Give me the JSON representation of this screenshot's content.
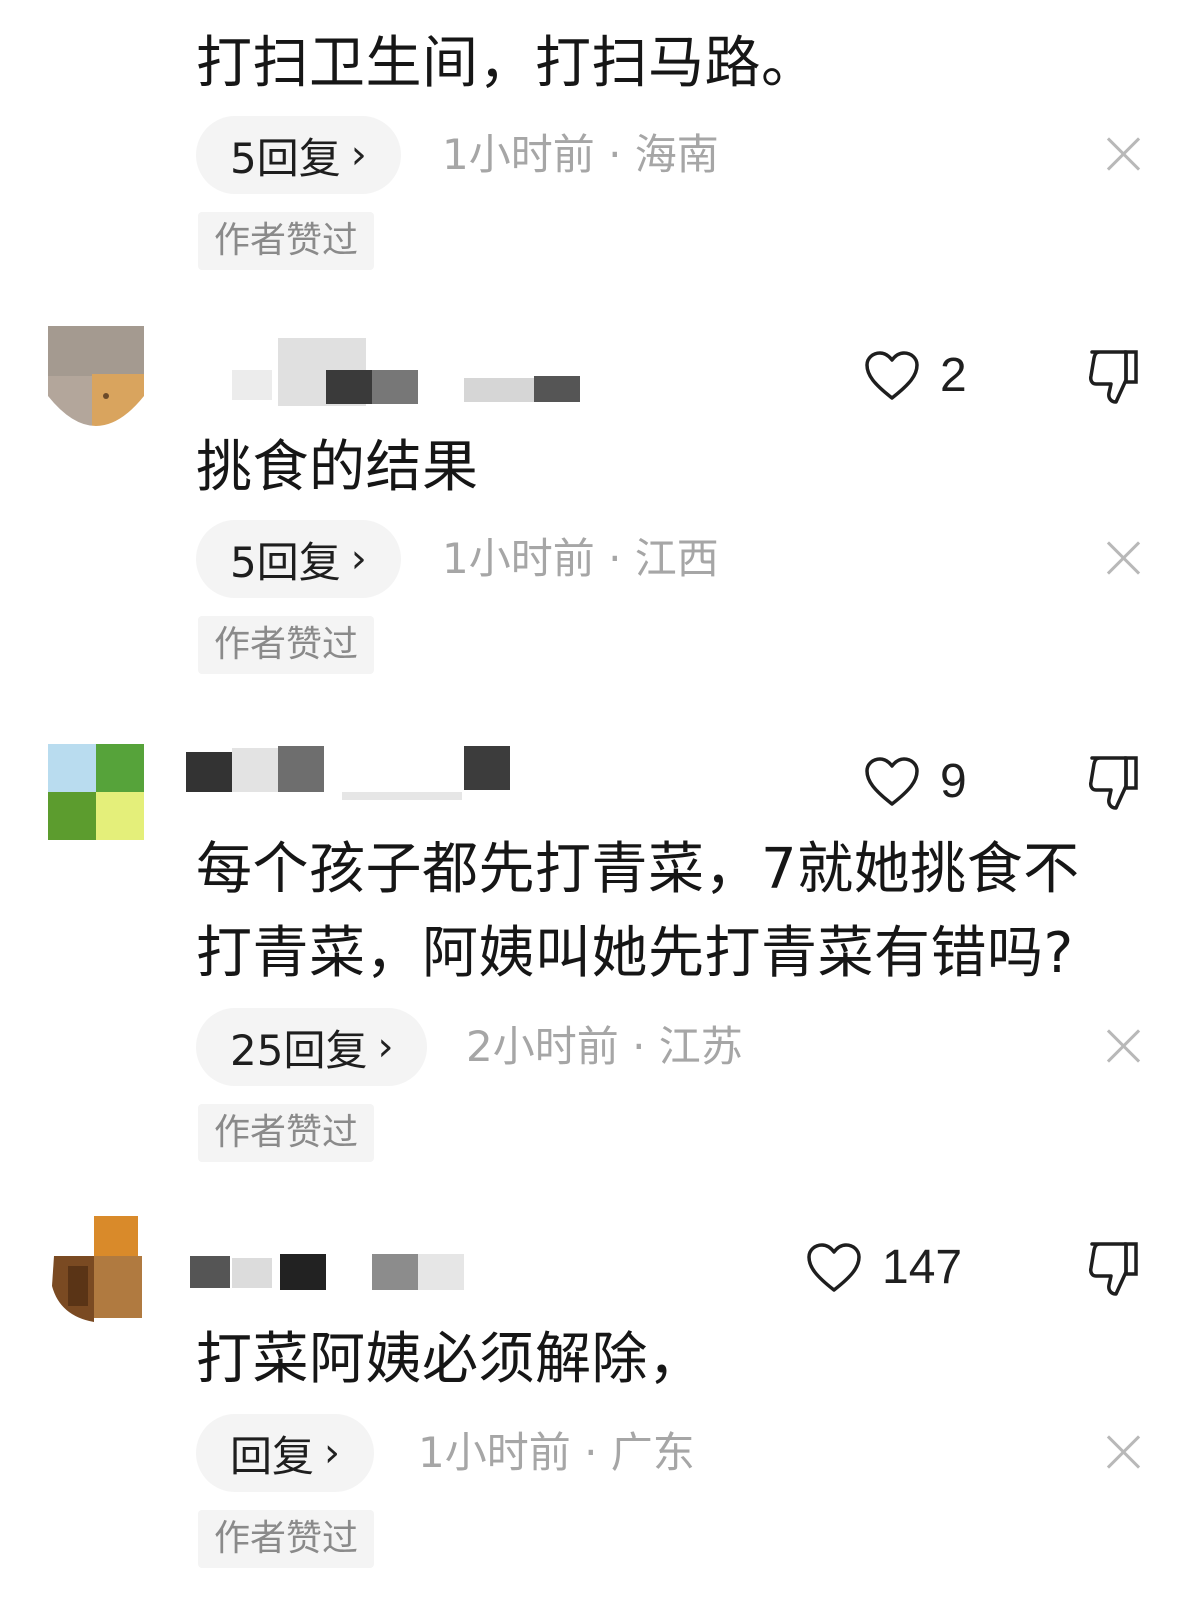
{
  "comments": [
    {
      "text": "打扫卫生间，打扫马路。",
      "reply_label": "5回复",
      "meta": "1小时前 · 海南",
      "badge": "作者赞过"
    },
    {
      "text": "挑食的结果",
      "likes": "2",
      "reply_label": "5回复",
      "meta": "1小时前 · 江西",
      "badge": "作者赞过"
    },
    {
      "text_line1": "每个孩子都先打青菜，7就她挑食不",
      "text_line2": "打青菜，阿姨叫她先打青菜有错吗?",
      "likes": "9",
      "reply_label": "25回复",
      "meta": "2小时前 · 江苏",
      "badge": "作者赞过"
    },
    {
      "text": "打菜阿姨必须解除，",
      "likes": "147",
      "reply_label": "回复",
      "meta": "1小时前 · 广东",
      "badge": "作者赞过"
    }
  ],
  "icons": {
    "like": "heart-outline-icon",
    "dislike": "thumbs-down-icon",
    "close": "close-icon",
    "reply_chevron": "chevron-right-icon"
  },
  "colors": {
    "text": "#161616",
    "meta": "#a6a6a6",
    "pill_bg": "#f4f4f4",
    "badge_text": "#8a8a8a"
  }
}
